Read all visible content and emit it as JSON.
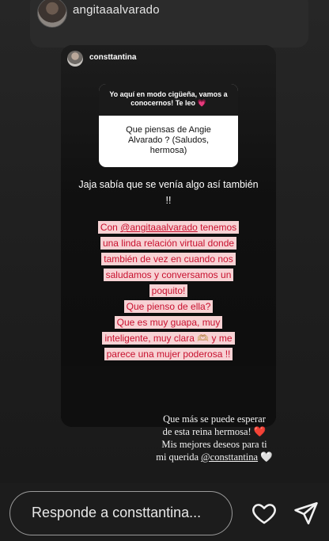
{
  "shared_story": {
    "username": "angitaaalvarado"
  },
  "inner_story": {
    "username": "consttantina",
    "question_sticker": {
      "prompt": "Yo aquí en modo cigüeña, vamos a conocernos! Te leo",
      "prompt_emoji": "💗",
      "question": "Que piensas de Angie Alvarado ? (Saludos, hermosa)"
    },
    "answer": "Jaja sabía que se venía algo así también !!",
    "pink_lines": [
      {
        "pre": "Con ",
        "mention": "@angitaaalvarado",
        "post": " tenemos una linda relación virtual donde también de vez en cuando nos saludamos y conversamos un poquito!"
      },
      {
        "pre": "Que pienso de ella?",
        "mention": "",
        "post": ""
      },
      {
        "pre": "Que es muy guapa, muy inteligente, muy clara 🫶🏼 y me parece una mujer poderosa !!",
        "mention": "",
        "post": ""
      }
    ]
  },
  "overlay": {
    "line1": "Que más se puede esperar",
    "line2": "de esta reina hermosa!",
    "heart1": "❤️",
    "line3": "Mis mejores deseos para ti",
    "line4_pre": "mi querida ",
    "line4_mention": "@consttantina",
    "heart2": "🤍"
  },
  "reply_bar": {
    "placeholder": "Responde a consttantina..."
  },
  "icons": {
    "like": "heart-outline-icon",
    "send": "paper-plane-icon"
  }
}
